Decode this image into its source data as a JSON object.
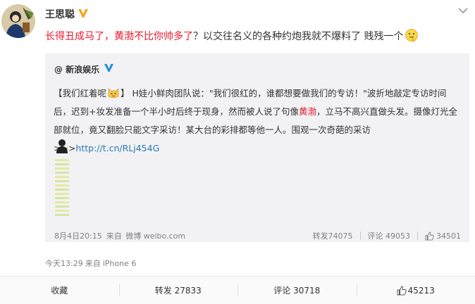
{
  "post": {
    "username": "王思聪",
    "text_highlight": "长得丑成马了，黄渤不比你帅多了",
    "text_rest": "？以交往名义的各种约炮我就不爆料了 贱残一个",
    "source_time": "今天13:29",
    "source_from": "来自",
    "source_device": "iPhone 6"
  },
  "repost": {
    "author": "@ 新浪娱乐",
    "text_tag_open": "【我们红着呢",
    "text_tag_close": "】",
    "text_a": "H娃小鲜肉团队说：\"我们很红的，谁都想要做我们的专访！\"波折地敲定专访时间后，迟到+妆发准备一个半小时后终于现身，然而被人说了句像",
    "text_name": "黄渤",
    "text_b": "，立马不高兴直做头发。摄像灯光全部就位，竟又翻脸只能文字采访！某大台的彩排都等他一人。围观一次奇葩的采访>>>",
    "link": "http://t.cn/RLj454G",
    "date": "8月4日20:15",
    "from_label": "来自",
    "source_app": "微博 weibo.com",
    "repost_label": "转发",
    "repost_count": "74075",
    "comment_label": "评论",
    "comment_count": "49053",
    "like_count": "34501"
  },
  "footer": {
    "favorite_label": "收藏",
    "repost_label": "转发",
    "repost_count": "27833",
    "comment_label": "评论",
    "comment_count": "30718",
    "like_count": "45213"
  },
  "colors": {
    "highlight": "#e6162d",
    "link": "#2a7ab0",
    "vip": "#f5a623",
    "repost_bg": "#f2f2f5"
  }
}
